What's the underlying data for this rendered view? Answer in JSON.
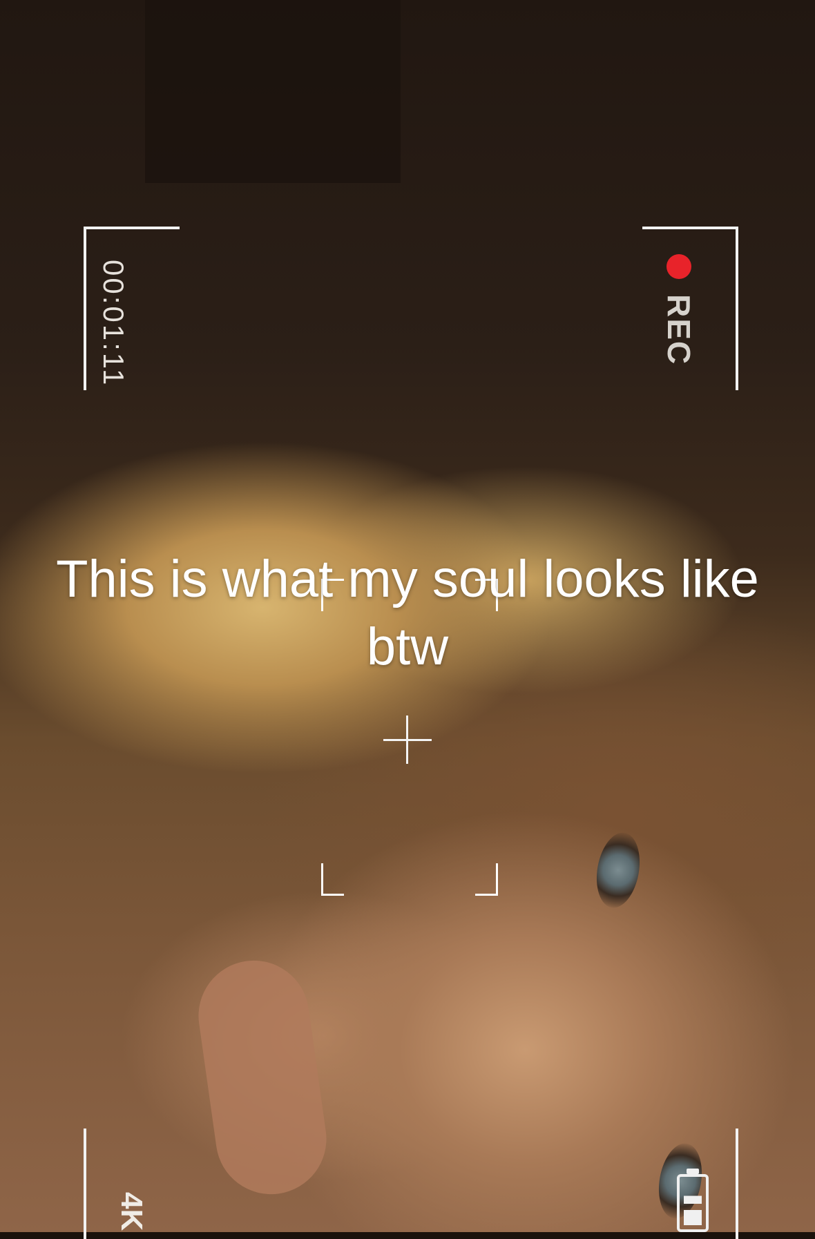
{
  "hud": {
    "timecode": "00:01:11",
    "rec_label": "REC",
    "quality_label": "4K",
    "rec_color": "#e8232a"
  },
  "caption": {
    "text": "This is what my soul looks like btw"
  },
  "icons": {
    "rec": "record-dot-icon",
    "battery": "battery-icon",
    "focus": "crosshair-icon"
  }
}
